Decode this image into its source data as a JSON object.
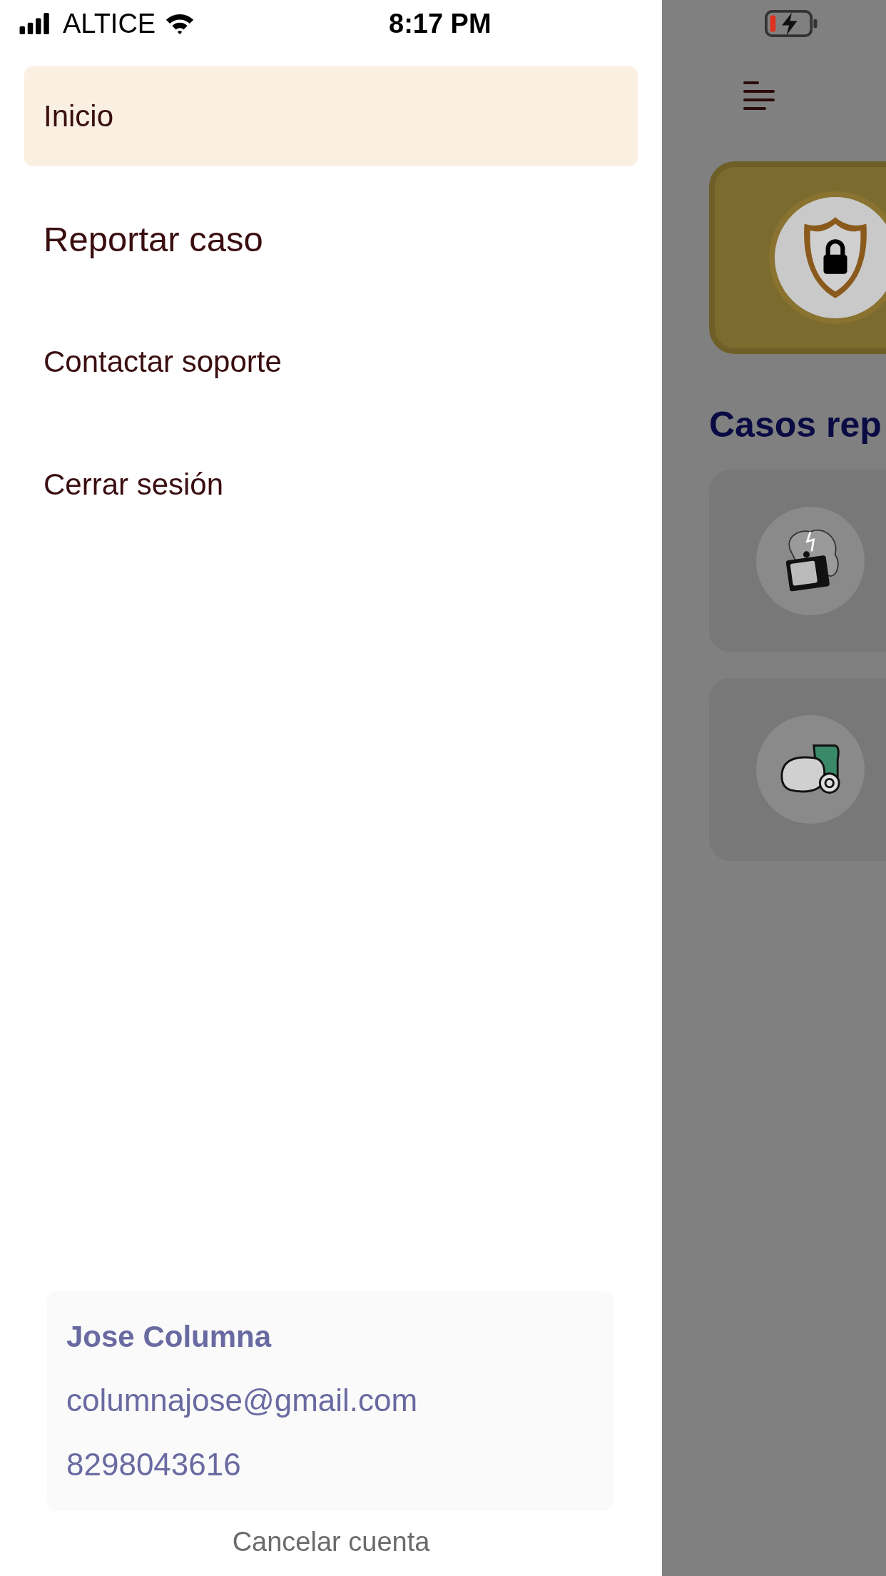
{
  "status_bar": {
    "carrier": "ALTICE",
    "time": "8:17 PM"
  },
  "menu": [
    {
      "label": "Inicio",
      "selected": true
    },
    {
      "label": "Reportar caso",
      "selected": false
    },
    {
      "label": "Contactar soporte",
      "selected": false
    },
    {
      "label": "Cerrar sesión",
      "selected": false
    }
  ],
  "profile": {
    "name": "Jose Columna",
    "email": "columnajose@gmail.com",
    "phone": "8298043616"
  },
  "cancel_link": "Cancelar cuenta",
  "background_screen": {
    "section_title": "Casos rep",
    "cases": [
      {
        "kind": "tv"
      },
      {
        "kind": "vacuum"
      }
    ]
  }
}
